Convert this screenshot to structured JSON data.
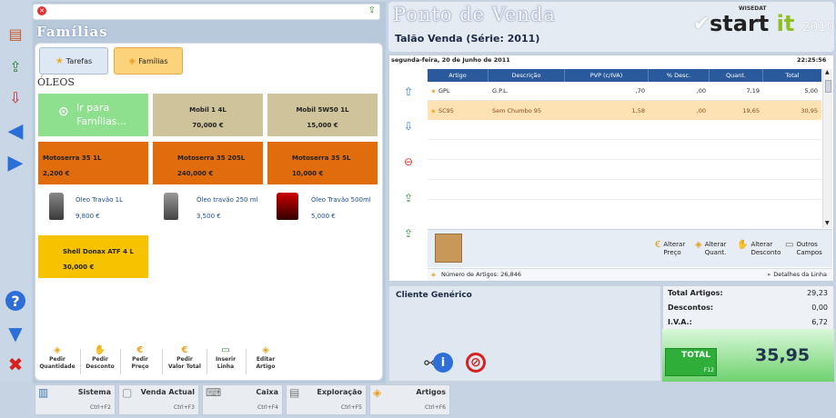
{
  "left_panel": {
    "title": "Famílias",
    "tabs": [
      {
        "label": "Tarefas"
      },
      {
        "label": "Famílias"
      }
    ],
    "category": "ÓLEOS",
    "go_families": "Ir para Famílias...",
    "tiles": [
      {
        "name": "Mobil 1 4L",
        "price": "70,000 €"
      },
      {
        "name": "Mobil 5W50 1L",
        "price": "15,000 €"
      },
      {
        "name": "Motoserra 35 1L",
        "price": "2,200 €"
      },
      {
        "name": "Motoserra 35 205L",
        "price": "240,000 €"
      },
      {
        "name": "Motoserra 35 5L",
        "price": "10,000 €"
      },
      {
        "name": "Shell Donax ATF 4 L",
        "price": "30,000 €"
      }
    ],
    "products": [
      {
        "name": "Óleo Travão 1L",
        "price": "9,800 €"
      },
      {
        "name": "Óleo travão 250 ml",
        "price": "3,500 €"
      },
      {
        "name": "Óleo Travão 500ml",
        "price": "5,000 €"
      }
    ],
    "actions": [
      {
        "line1": "Pedir",
        "line2": "Quantidade"
      },
      {
        "line1": "Pedir",
        "line2": "Desconto"
      },
      {
        "line1": "Pedir",
        "line2": "Preço"
      },
      {
        "line1": "Pedir",
        "line2": "Valor Total"
      },
      {
        "line1": "Inserir",
        "line2": "Linha"
      },
      {
        "line1": "Editar",
        "line2": "Artigo"
      }
    ]
  },
  "bottom_menu": [
    {
      "label": "Sistema",
      "key": "Ctrl+F2"
    },
    {
      "label": "Venda Actual",
      "key": "Ctrl+F3"
    },
    {
      "label": "Caixa",
      "key": "Ctrl+F4"
    },
    {
      "label": "Exploração",
      "key": "Ctrl+F5"
    },
    {
      "label": "Artigos",
      "key": "Ctrl+F6"
    }
  ],
  "header": {
    "title": "Ponto de Venda",
    "subtitle": "Talão Venda (Série: 2011)",
    "logo_small": "WISEDAT",
    "logo_start": "start",
    "logo_it": "it",
    "logo_year": "2010"
  },
  "grid": {
    "date": "segunda-feira, 20 de Junho de 2011",
    "time": "22:25:56",
    "columns": [
      "Artigo",
      "Descrição",
      "PVP (c/IVA)",
      "% Desc.",
      "Quant.",
      "Total"
    ],
    "rows": [
      [
        "GPL",
        "G.P.L.",
        ",70",
        ",00",
        "7,19",
        "5,00"
      ],
      [
        "SC95",
        "Sem Chumbo 95",
        "1,58",
        ",00",
        "19,65",
        "30,95"
      ]
    ],
    "actions": [
      {
        "line1": "Alterar",
        "line2": "Preço"
      },
      {
        "line1": "Alterar",
        "line2": "Quant."
      },
      {
        "line1": "Alterar",
        "line2": "Desconto"
      },
      {
        "line1": "Outros",
        "line2": "Campos"
      }
    ],
    "article_count": "Número de Artigos: 26,846",
    "details": "Detalhes da Linha"
  },
  "client": {
    "name": "Cliente Genérico"
  },
  "totals": {
    "rows": [
      {
        "label": "Total Artigos:",
        "value": "29,23"
      },
      {
        "label": "Descontos:",
        "value": "0,00"
      },
      {
        "label": "I.V.A.:",
        "value": "6,72"
      }
    ],
    "total_label": "TOTAL",
    "total_key": "F12",
    "total_value": "35,95"
  },
  "colors": {
    "accent": "#2a5a9c",
    "orange": "#e06c0c",
    "khaki": "#cfc39c",
    "green_tile": "#8ee08e",
    "yellow_tile": "#f7c200",
    "tab_active": "#fcd27a"
  }
}
